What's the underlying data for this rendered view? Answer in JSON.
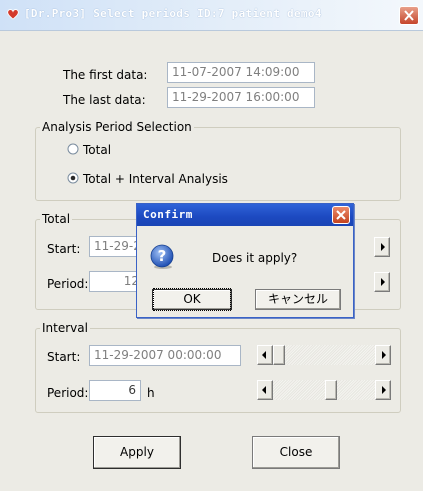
{
  "window": {
    "title": "[Dr.Pro3] Select periods  ID:7 patient demo4"
  },
  "info": {
    "first_label": "The first data:",
    "first_value": "11-07-2007 14:09:00",
    "last_label": "The last data:",
    "last_value": "11-29-2007 16:00:00"
  },
  "analysis": {
    "legend": "Analysis Period Selection",
    "opt_total": "Total",
    "opt_interval": "Total + Interval Analysis",
    "selected": "Total + Interval Analysis"
  },
  "total": {
    "legend": "Total",
    "start_label": "Start:",
    "start_value": "11-29-2",
    "period_label": "Period:",
    "period_value": "12"
  },
  "interval": {
    "legend": "Interval",
    "start_label": "Start:",
    "start_value": "11-29-2007 00:00:00",
    "start_position": 0.0,
    "period_label": "Period:",
    "period_value": "6",
    "period_unit": "h",
    "period_position": 0.58
  },
  "buttons": {
    "apply": "Apply",
    "close": "Close"
  },
  "dialog": {
    "title": "Confirm",
    "message": "Does it apply?",
    "ok": "OK",
    "cancel": "キャンセル"
  },
  "colors": {
    "dialog_title": "#1c49c0",
    "close_button": "#c5452b",
    "window_bg": "#ecebe5"
  }
}
